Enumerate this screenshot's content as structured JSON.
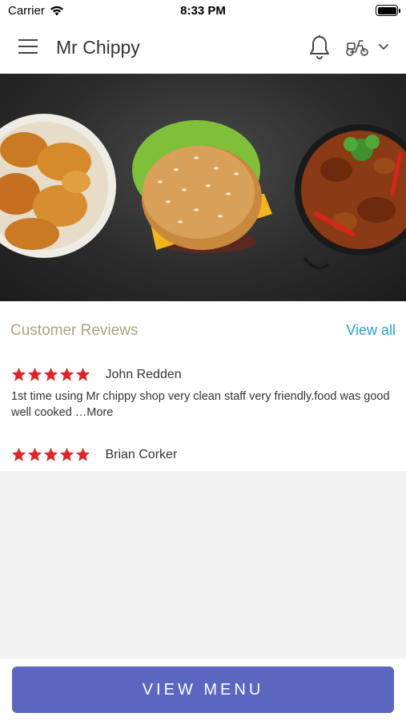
{
  "status": {
    "carrier": "Carrier",
    "time": "8:33 PM"
  },
  "nav": {
    "title": "Mr Chippy",
    "icons": [
      "hamburger-menu-icon",
      "bell-icon",
      "scooter-icon",
      "chevron-down-icon"
    ]
  },
  "hero": {
    "image": "food banner: fried chicken, burger, curry"
  },
  "reviews": {
    "heading": "Customer Reviews",
    "view_all": "View all",
    "items": [
      {
        "rating": 5,
        "name": "John Redden",
        "text": "1st time using Mr chippy shop very clean staff very friendly.food was good well cooked …More"
      },
      {
        "rating": 5,
        "name": "Brian Corker",
        "text": ""
      }
    ]
  },
  "footer": {
    "button_label": "VIEW MENU"
  },
  "colors": {
    "accent_button": "#5a66c0",
    "link": "#2aa0c8",
    "star": "#d9262b",
    "heading": "#b0a080"
  }
}
